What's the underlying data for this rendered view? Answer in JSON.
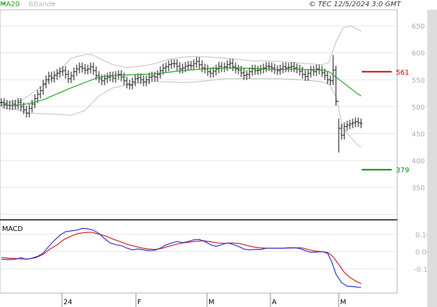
{
  "header": {
    "ma_label": "MA20",
    "bb_label": "BBands",
    "copyright": "© TEC 12/5/2024 3:0 GMT"
  },
  "colors": {
    "ma": "#1aa01a",
    "bands": "#bcbcbc",
    "price": "#000000",
    "macd": "#1f2fd6",
    "signal": "#d01414",
    "resistance": "#cc0000",
    "support": "#008800",
    "grid": "#e4e4e4",
    "axis": "#b0b0b0",
    "tick_text": "#aaaaaa"
  },
  "price_axis": {
    "ticks": [
      "650",
      "600",
      "550",
      "500",
      "450",
      "400",
      "350"
    ],
    "range": [
      290,
      680
    ]
  },
  "levels": [
    {
      "label": "561",
      "value": 565,
      "kind": "resistance"
    },
    {
      "label": "379",
      "value": 383,
      "kind": "support"
    }
  ],
  "macd_panel": {
    "title": "MACD",
    "ticks": [
      "0.10",
      "0.00",
      "-0.10"
    ],
    "range": [
      -0.24,
      0.18
    ]
  },
  "time_axis": {
    "labels": [
      "24",
      "F",
      "M",
      "A",
      "M"
    ]
  },
  "chart_data": {
    "type": "bar",
    "title": "",
    "price": {
      "points": [
        [
          0,
          508
        ],
        [
          4,
          505
        ],
        [
          8,
          503
        ],
        [
          12,
          502
        ],
        [
          16,
          505
        ],
        [
          20,
          503
        ],
        [
          24,
          508
        ],
        [
          28,
          500
        ],
        [
          32,
          494
        ],
        [
          36,
          488
        ],
        [
          40,
          497
        ],
        [
          44,
          505
        ],
        [
          48,
          515
        ],
        [
          52,
          523
        ],
        [
          56,
          530
        ],
        [
          60,
          542
        ],
        [
          64,
          550
        ],
        [
          68,
          557
        ],
        [
          72,
          553
        ],
        [
          76,
          558
        ],
        [
          80,
          562
        ],
        [
          84,
          565
        ],
        [
          88,
          567
        ],
        [
          92,
          560
        ],
        [
          96,
          552
        ],
        [
          100,
          557
        ],
        [
          104,
          565
        ],
        [
          108,
          570
        ],
        [
          112,
          574
        ],
        [
          116,
          571
        ],
        [
          120,
          568
        ],
        [
          124,
          570
        ],
        [
          128,
          574
        ],
        [
          132,
          567
        ],
        [
          136,
          558
        ],
        [
          140,
          552
        ],
        [
          144,
          548
        ],
        [
          148,
          552
        ],
        [
          152,
          555
        ],
        [
          156,
          557
        ],
        [
          160,
          553
        ],
        [
          164,
          558
        ],
        [
          168,
          560
        ],
        [
          172,
          555
        ],
        [
          176,
          548
        ],
        [
          180,
          542
        ],
        [
          184,
          540
        ],
        [
          188,
          546
        ],
        [
          192,
          552
        ],
        [
          196,
          554
        ],
        [
          200,
          550
        ],
        [
          204,
          546
        ],
        [
          208,
          550
        ],
        [
          212,
          555
        ],
        [
          216,
          557
        ],
        [
          220,
          555
        ],
        [
          224,
          560
        ],
        [
          228,
          567
        ],
        [
          232,
          572
        ],
        [
          236,
          574
        ],
        [
          240,
          578
        ],
        [
          244,
          580
        ],
        [
          248,
          580
        ],
        [
          252,
          575
        ],
        [
          256,
          570
        ],
        [
          260,
          572
        ],
        [
          264,
          575
        ],
        [
          268,
          577
        ],
        [
          272,
          576
        ],
        [
          276,
          580
        ],
        [
          280,
          584
        ],
        [
          284,
          578
        ],
        [
          288,
          572
        ],
        [
          292,
          570
        ],
        [
          296,
          565
        ],
        [
          300,
          562
        ],
        [
          304,
          566
        ],
        [
          308,
          570
        ],
        [
          312,
          575
        ],
        [
          316,
          572
        ],
        [
          320,
          574
        ],
        [
          324,
          578
        ],
        [
          328,
          581
        ],
        [
          332,
          574
        ],
        [
          336,
          570
        ],
        [
          340,
          568
        ],
        [
          344,
          563
        ],
        [
          348,
          558
        ],
        [
          352,
          560
        ],
        [
          356,
          565
        ],
        [
          360,
          570
        ],
        [
          364,
          567
        ],
        [
          368,
          568
        ],
        [
          372,
          570
        ],
        [
          376,
          572
        ],
        [
          380,
          575
        ],
        [
          384,
          574
        ],
        [
          388,
          572
        ],
        [
          392,
          569
        ],
        [
          396,
          567
        ],
        [
          400,
          570
        ],
        [
          404,
          574
        ],
        [
          408,
          572
        ],
        [
          412,
          573
        ],
        [
          416,
          575
        ],
        [
          420,
          572
        ],
        [
          424,
          570
        ],
        [
          428,
          566
        ],
        [
          432,
          560
        ],
        [
          436,
          556
        ],
        [
          440,
          562
        ],
        [
          444,
          568
        ],
        [
          448,
          565
        ],
        [
          452,
          570
        ],
        [
          456,
          568
        ],
        [
          460,
          563
        ],
        [
          464,
          558
        ],
        [
          468,
          550
        ],
        [
          472,
          548
        ],
        [
          476,
          568
        ],
        [
          480,
          510
        ],
        [
          484,
          460
        ],
        [
          488,
          447
        ],
        [
          492,
          463
        ],
        [
          496,
          466
        ],
        [
          500,
          468
        ],
        [
          504,
          470
        ],
        [
          508,
          472
        ],
        [
          512,
          470
        ],
        [
          516,
          468
        ]
      ],
      "ma20": [
        [
          0,
          503
        ],
        [
          20,
          502
        ],
        [
          40,
          506
        ],
        [
          60,
          513
        ],
        [
          80,
          524
        ],
        [
          100,
          535
        ],
        [
          120,
          545
        ],
        [
          140,
          555
        ],
        [
          160,
          558
        ],
        [
          180,
          559
        ],
        [
          200,
          560
        ],
        [
          220,
          561
        ],
        [
          240,
          564
        ],
        [
          260,
          567
        ],
        [
          280,
          569
        ],
        [
          300,
          571
        ],
        [
          320,
          572
        ],
        [
          340,
          572
        ],
        [
          360,
          571
        ],
        [
          380,
          570
        ],
        [
          400,
          569
        ],
        [
          420,
          570
        ],
        [
          440,
          569
        ],
        [
          460,
          568
        ],
        [
          470,
          565
        ],
        [
          480,
          555
        ],
        [
          490,
          545
        ],
        [
          500,
          535
        ],
        [
          510,
          525
        ],
        [
          516,
          520
        ]
      ],
      "upper": [
        [
          0,
          506
        ],
        [
          30,
          512
        ],
        [
          60,
          540
        ],
        [
          80,
          562
        ],
        [
          100,
          590
        ],
        [
          120,
          597
        ],
        [
          130,
          597
        ],
        [
          140,
          590
        ],
        [
          160,
          578
        ],
        [
          180,
          573
        ],
        [
          200,
          575
        ],
        [
          220,
          580
        ],
        [
          240,
          588
        ],
        [
          260,
          592
        ],
        [
          280,
          593
        ],
        [
          300,
          592
        ],
        [
          320,
          590
        ],
        [
          340,
          588
        ],
        [
          360,
          585
        ],
        [
          380,
          585
        ],
        [
          400,
          584
        ],
        [
          420,
          582
        ],
        [
          440,
          580
        ],
        [
          460,
          578
        ],
        [
          470,
          582
        ],
        [
          480,
          620
        ],
        [
          490,
          646
        ],
        [
          500,
          650
        ],
        [
          510,
          645
        ],
        [
          516,
          640
        ]
      ],
      "lower": [
        [
          0,
          498
        ],
        [
          20,
          495
        ],
        [
          40,
          488
        ],
        [
          60,
          487
        ],
        [
          80,
          486
        ],
        [
          100,
          484
        ],
        [
          120,
          493
        ],
        [
          140,
          520
        ],
        [
          160,
          535
        ],
        [
          180,
          540
        ],
        [
          200,
          545
        ],
        [
          220,
          547
        ],
        [
          240,
          546
        ],
        [
          260,
          545
        ],
        [
          280,
          546
        ],
        [
          300,
          549
        ],
        [
          320,
          552
        ],
        [
          340,
          552
        ],
        [
          360,
          552
        ],
        [
          380,
          552
        ],
        [
          400,
          552
        ],
        [
          420,
          551
        ],
        [
          440,
          549
        ],
        [
          460,
          546
        ],
        [
          470,
          542
        ],
        [
          480,
          520
        ],
        [
          490,
          460
        ],
        [
          500,
          445
        ],
        [
          510,
          430
        ],
        [
          516,
          425
        ]
      ]
    },
    "macd": {
      "macd": [
        [
          0,
          -0.045
        ],
        [
          10,
          -0.046
        ],
        [
          20,
          -0.045
        ],
        [
          28,
          -0.035
        ],
        [
          36,
          -0.045
        ],
        [
          44,
          -0.038
        ],
        [
          52,
          -0.028
        ],
        [
          60,
          -0.008
        ],
        [
          68,
          0.03
        ],
        [
          76,
          0.065
        ],
        [
          84,
          0.095
        ],
        [
          92,
          0.115
        ],
        [
          100,
          0.12
        ],
        [
          108,
          0.124
        ],
        [
          116,
          0.134
        ],
        [
          124,
          0.132
        ],
        [
          132,
          0.124
        ],
        [
          140,
          0.105
        ],
        [
          148,
          0.075
        ],
        [
          156,
          0.05
        ],
        [
          164,
          0.04
        ],
        [
          172,
          0.035
        ],
        [
          180,
          0.02
        ],
        [
          188,
          0.01
        ],
        [
          196,
          0.015
        ],
        [
          204,
          0.01
        ],
        [
          212,
          0.005
        ],
        [
          220,
          0.007
        ],
        [
          228,
          0.02
        ],
        [
          236,
          0.038
        ],
        [
          244,
          0.05
        ],
        [
          252,
          0.058
        ],
        [
          260,
          0.052
        ],
        [
          268,
          0.058
        ],
        [
          276,
          0.068
        ],
        [
          284,
          0.07
        ],
        [
          292,
          0.058
        ],
        [
          300,
          0.04
        ],
        [
          308,
          0.03
        ],
        [
          316,
          0.04
        ],
        [
          324,
          0.05
        ],
        [
          332,
          0.042
        ],
        [
          340,
          0.03
        ],
        [
          348,
          0.015
        ],
        [
          356,
          0.01
        ],
        [
          364,
          0.013
        ],
        [
          372,
          0.012
        ],
        [
          380,
          0.02
        ],
        [
          388,
          0.02
        ],
        [
          396,
          0.02
        ],
        [
          404,
          0.02
        ],
        [
          412,
          0.022
        ],
        [
          420,
          0.022
        ],
        [
          428,
          0.018
        ],
        [
          436,
          0.005
        ],
        [
          444,
          -0.004
        ],
        [
          452,
          -0.002
        ],
        [
          460,
          0.0
        ],
        [
          468,
          -0.01
        ],
        [
          474,
          -0.06
        ],
        [
          480,
          -0.13
        ],
        [
          488,
          -0.18
        ],
        [
          496,
          -0.2
        ],
        [
          504,
          -0.202
        ],
        [
          512,
          -0.206
        ],
        [
          516,
          -0.207
        ]
      ],
      "signal": [
        [
          0,
          -0.035
        ],
        [
          10,
          -0.038
        ],
        [
          20,
          -0.04
        ],
        [
          30,
          -0.043
        ],
        [
          40,
          -0.042
        ],
        [
          50,
          -0.035
        ],
        [
          60,
          -0.015
        ],
        [
          70,
          0.015
        ],
        [
          80,
          0.04
        ],
        [
          90,
          0.07
        ],
        [
          100,
          0.09
        ],
        [
          110,
          0.105
        ],
        [
          120,
          0.11
        ],
        [
          130,
          0.112
        ],
        [
          140,
          0.1
        ],
        [
          150,
          0.09
        ],
        [
          160,
          0.072
        ],
        [
          170,
          0.058
        ],
        [
          180,
          0.042
        ],
        [
          190,
          0.032
        ],
        [
          200,
          0.022
        ],
        [
          210,
          0.015
        ],
        [
          220,
          0.012
        ],
        [
          230,
          0.018
        ],
        [
          240,
          0.03
        ],
        [
          250,
          0.042
        ],
        [
          260,
          0.05
        ],
        [
          270,
          0.055
        ],
        [
          280,
          0.06
        ],
        [
          290,
          0.063
        ],
        [
          300,
          0.057
        ],
        [
          310,
          0.05
        ],
        [
          320,
          0.048
        ],
        [
          330,
          0.05
        ],
        [
          340,
          0.048
        ],
        [
          350,
          0.038
        ],
        [
          360,
          0.028
        ],
        [
          370,
          0.022
        ],
        [
          380,
          0.02
        ],
        [
          390,
          0.02
        ],
        [
          400,
          0.02
        ],
        [
          410,
          0.02
        ],
        [
          420,
          0.021
        ],
        [
          430,
          0.022
        ],
        [
          440,
          0.012
        ],
        [
          450,
          0.003
        ],
        [
          460,
          0.0
        ],
        [
          468,
          -0.005
        ],
        [
          476,
          -0.03
        ],
        [
          484,
          -0.075
        ],
        [
          492,
          -0.12
        ],
        [
          500,
          -0.15
        ],
        [
          508,
          -0.17
        ],
        [
          516,
          -0.186
        ]
      ]
    }
  }
}
